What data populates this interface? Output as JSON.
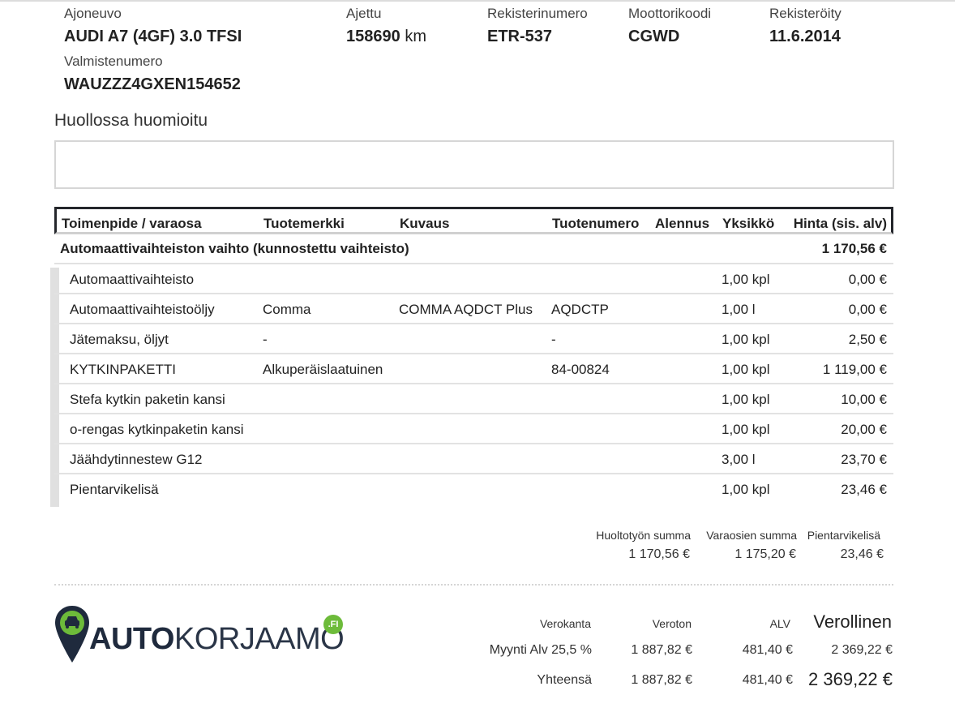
{
  "vehicle": {
    "model_label": "Ajoneuvo",
    "model": "AUDI A7 (4GF) 3.0 TFSI",
    "mileage_label": "Ajettu",
    "mileage": "158690",
    "mileage_unit": "km",
    "reg_label": "Rekisterinumero",
    "reg": "ETR-537",
    "engine_label": "Moottorikoodi",
    "engine": "CGWD",
    "registered_label": "Rekisteröity",
    "registered": "11.6.2014",
    "vin_label": "Valmistenumero",
    "vin": "WAUZZZ4GXEN154652"
  },
  "notes": {
    "title": "Huollossa huomioitu",
    "text": ""
  },
  "table": {
    "headers": [
      "Toimenpide / varaosa",
      "Tuotemerkki",
      "Kuvaus",
      "Tuotenumero",
      "Alennus",
      "Yksikkö",
      "Hinta (sis. alv)"
    ],
    "group": {
      "title": "Automaattivaihteiston vaihto (kunnostettu vaihteisto)",
      "price": "1 170,56 €"
    },
    "rows": [
      {
        "name": "Automaattivaihteisto",
        "brand": "",
        "desc": "",
        "code": "",
        "discount": "",
        "unit": "1,00 kpl",
        "price": "0,00 €"
      },
      {
        "name": "Automaattivaihteistoöljy",
        "brand": "Comma",
        "desc": "COMMA AQDCT Plus",
        "code": "AQDCTP",
        "discount": "",
        "unit": "1,00 l",
        "price": "0,00 €"
      },
      {
        "name": "Jätemaksu, öljyt",
        "brand": "-",
        "desc": "",
        "code": "-",
        "discount": "",
        "unit": "1,00 kpl",
        "price": "2,50 €"
      },
      {
        "name": "KYTKINPAKETTI",
        "brand": "Alkuperäislaatuinen",
        "desc": "",
        "code": "84-00824",
        "discount": "",
        "unit": "1,00 kpl",
        "price": "1 119,00 €"
      },
      {
        "name": "Stefa kytkin paketin kansi",
        "brand": "",
        "desc": "",
        "code": "",
        "discount": "",
        "unit": "1,00 kpl",
        "price": "10,00 €"
      },
      {
        "name": "o-rengas kytkinpaketin kansi",
        "brand": "",
        "desc": "",
        "code": "",
        "discount": "",
        "unit": "1,00 kpl",
        "price": "20,00 €"
      },
      {
        "name": "Jäähdytinnestew G12",
        "brand": "",
        "desc": "",
        "code": "",
        "discount": "",
        "unit": "3,00 l",
        "price": "23,70 €"
      },
      {
        "name": "Pientarvikelisä",
        "brand": "",
        "desc": "",
        "code": "",
        "discount": "",
        "unit": "1,00 kpl",
        "price": "23,46 €"
      }
    ]
  },
  "summary": {
    "labor_label": "Huoltotyön summa",
    "labor": "1 170,56 €",
    "parts_label": "Varaosien summa",
    "parts": "1 175,20 €",
    "supplies_label": "Pientarvikelisä",
    "supplies": "23,46 €"
  },
  "logo": {
    "bold": "AUTO",
    "light": "KORJAAMO",
    "badge": ".FI",
    "pin_color": "#1f2a3d",
    "accent_color": "#6dbb3a"
  },
  "tax": {
    "h_rate": "Verokanta",
    "h_net": "Veroton",
    "h_vat": "ALV",
    "h_gross": "Verollinen",
    "rate_label": "Myynti Alv 25,5 %",
    "net": "1 887,82 €",
    "vat": "481,40 €",
    "gross": "2 369,22 €",
    "total_label": "Yhteensä",
    "total_net": "1 887,82 €",
    "total_vat": "481,40 €",
    "total_gross": "2 369,22 €"
  }
}
